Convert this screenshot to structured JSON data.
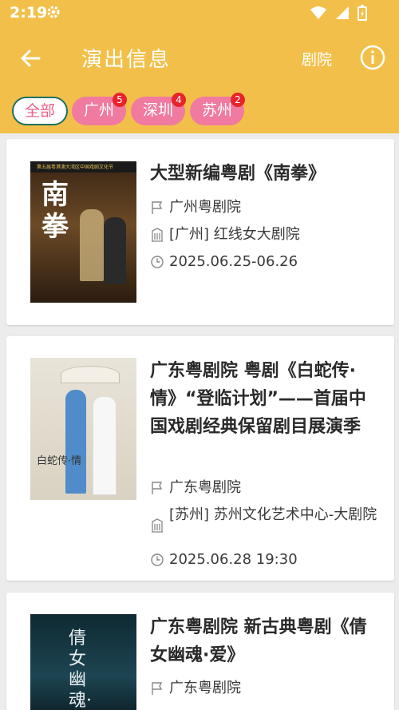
{
  "status_bar": {
    "time": "2:19"
  },
  "header": {
    "title": "演出信息",
    "theater_label": "剧院"
  },
  "filters": [
    {
      "label": "全部",
      "badge": ""
    },
    {
      "label": "广州",
      "badge": "5"
    },
    {
      "label": "深圳",
      "badge": "4"
    },
    {
      "label": "苏州",
      "badge": "2"
    }
  ],
  "cards": [
    {
      "title": "大型新编粤剧《南拳》",
      "troupe": "广州粤剧院",
      "venue": "[广州] 红线女大剧院",
      "date": "2025.06.25-06.26",
      "poster_text": "南拳",
      "poster_banner": "第五届粤港澳大湾区中国戏剧文化节"
    },
    {
      "title": "广东粤剧院 粤剧《白蛇传·情》“登临计划”——首届中国戏剧经典保留剧目展演季",
      "troupe": "广东粤剧院",
      "venue": "[苏州] 苏州文化艺术中心-大剧院",
      "date": "2025.06.28 19:30",
      "poster_text": "白蛇传·情"
    },
    {
      "title": "广东粤剧院 新古典粤剧《倩女幽魂·爱》",
      "troupe": "广东粤剧院",
      "poster_text": "倩女幽魂·爱"
    }
  ]
}
